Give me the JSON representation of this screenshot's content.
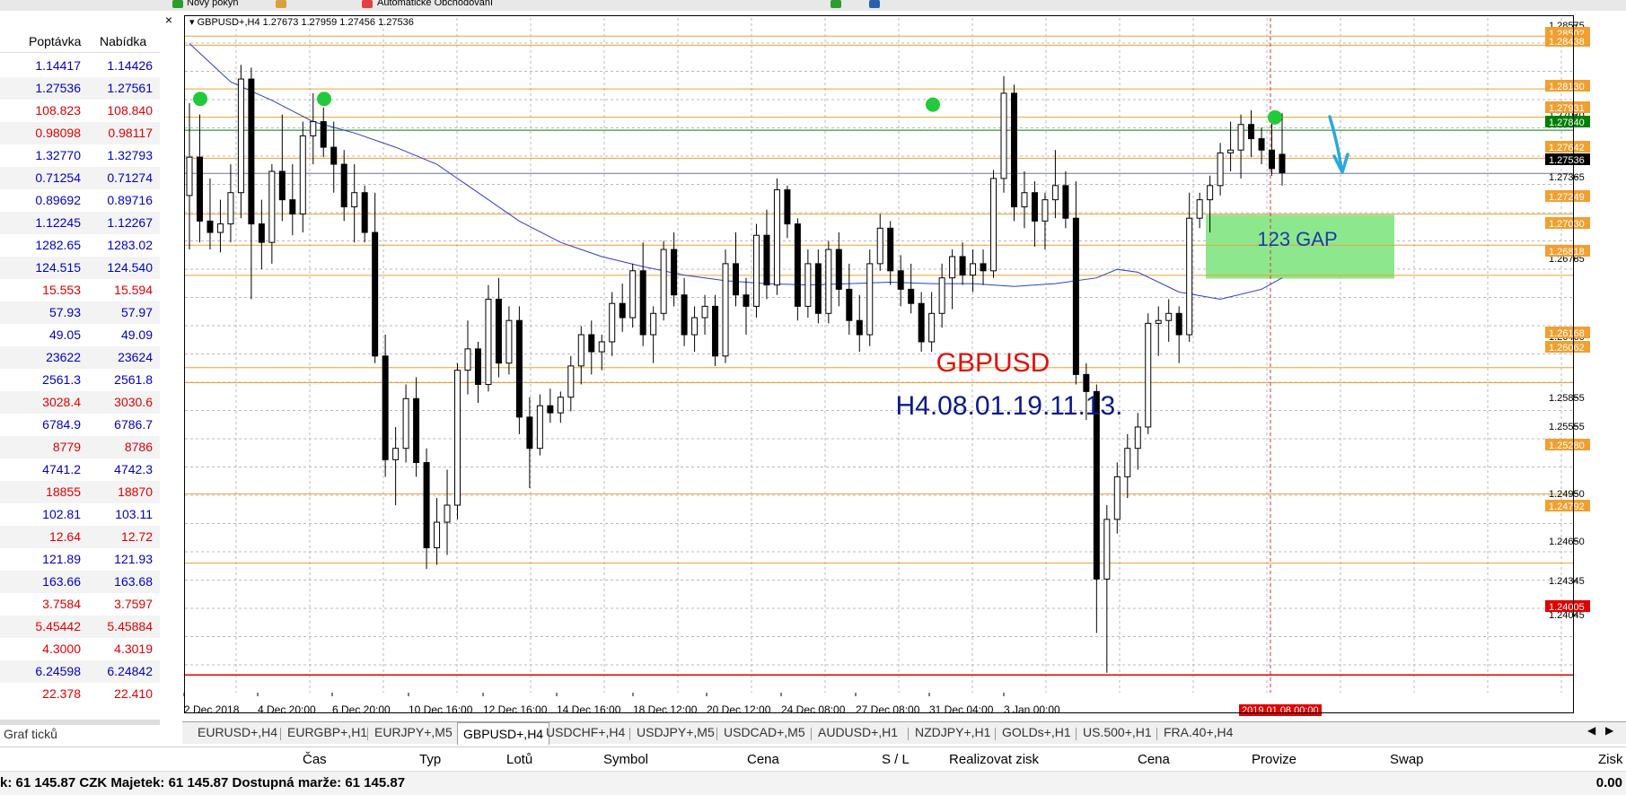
{
  "toolbar": {
    "new_order_label": "Nový pokyn",
    "autotrading_label": "Automatické Obchodování"
  },
  "market_watch": {
    "headers": {
      "bid": "Poptávka",
      "ask": "Nabídka"
    },
    "rows": [
      {
        "bid": "1.14417",
        "ask": "1.14426",
        "color": "#0000c8"
      },
      {
        "bid": "1.27536",
        "ask": "1.27561",
        "color": "#0000c8"
      },
      {
        "bid": "108.823",
        "ask": "108.840",
        "color": "#e00000"
      },
      {
        "bid": "0.98098",
        "ask": "0.98117",
        "color": "#e00000"
      },
      {
        "bid": "1.32770",
        "ask": "1.32793",
        "color": "#0000c8"
      },
      {
        "bid": "0.71254",
        "ask": "0.71274",
        "color": "#0000c8"
      },
      {
        "bid": "0.89692",
        "ask": "0.89716",
        "color": "#0000c8"
      },
      {
        "bid": "1.12245",
        "ask": "1.12267",
        "color": "#0000c8"
      },
      {
        "bid": "1282.65",
        "ask": "1283.02",
        "color": "#0000c8"
      },
      {
        "bid": "124.515",
        "ask": "124.540",
        "color": "#0000c8"
      },
      {
        "bid": "15.553",
        "ask": "15.594",
        "color": "#e00000"
      },
      {
        "bid": "57.93",
        "ask": "57.97",
        "color": "#0000c8"
      },
      {
        "bid": "49.05",
        "ask": "49.09",
        "color": "#0000c8"
      },
      {
        "bid": "23622",
        "ask": "23624",
        "color": "#0000c8"
      },
      {
        "bid": "2561.3",
        "ask": "2561.8",
        "color": "#0000c8"
      },
      {
        "bid": "3028.4",
        "ask": "3030.6",
        "color": "#e00000"
      },
      {
        "bid": "6784.9",
        "ask": "6786.7",
        "color": "#0000c8"
      },
      {
        "bid": "8779",
        "ask": "8786",
        "color": "#e00000"
      },
      {
        "bid": "4741.2",
        "ask": "4742.3",
        "color": "#0000c8"
      },
      {
        "bid": "18855",
        "ask": "18870",
        "color": "#e00000"
      },
      {
        "bid": "102.81",
        "ask": "103.11",
        "color": "#0000c8"
      },
      {
        "bid": "12.64",
        "ask": "12.72",
        "color": "#e00000"
      },
      {
        "bid": "121.89",
        "ask": "121.93",
        "color": "#0000c8"
      },
      {
        "bid": "163.66",
        "ask": "163.68",
        "color": "#0000c8"
      },
      {
        "bid": "3.7584",
        "ask": "3.7597",
        "color": "#e00000"
      },
      {
        "bid": "5.45442",
        "ask": "5.45884",
        "color": "#e00000"
      },
      {
        "bid": "4.3000",
        "ask": "4.3019",
        "color": "#e00000"
      },
      {
        "bid": "6.24598",
        "ask": "6.24842",
        "color": "#0000c8"
      },
      {
        "bid": "22.378",
        "ask": "22.410",
        "color": "#e00000"
      }
    ],
    "tab_label": "Graf ticků"
  },
  "chart_data": {
    "type": "candlestick",
    "symbol_header": "GBPUSD+,H4  1.27673 1.27959 1.27456 1.27536",
    "title": "GBPUSD",
    "subtitle": "H4.08.01.19.11.13.",
    "gap_label": "123 GAP",
    "ylim": [
      1.2388,
      1.2863
    ],
    "price_ticks": [
      "1.28575",
      "1.27070",
      "1.27365",
      "1.26785",
      "1.26460",
      "1.25855",
      "1.25555",
      "1.24950",
      "1.24650",
      "1.24345",
      "1.24045"
    ],
    "time_labels": [
      "2 Dec 2018",
      "4 Dec 20:00",
      "6 Dec 20:00",
      "10 Dec 16:00",
      "12 Dec 16:00",
      "14 Dec 16:00",
      "18 Dec 12:00",
      "20 Dec 12:00",
      "24 Dec 08:00",
      "27 Dec 08:00",
      "31 Dec 04:00",
      "3 Jan 00:00"
    ],
    "current_time_label": "2019.01.08 00:00",
    "horizontal_levels": [
      {
        "price": 1.28502,
        "label": "1.28502",
        "color": "#f0a030"
      },
      {
        "price": 1.28438,
        "label": "1.28438",
        "color": "#f0a030"
      },
      {
        "price": 1.2813,
        "label": "1.28130",
        "color": "#f0a030"
      },
      {
        "price": 1.27931,
        "label": "1.27931",
        "color": "#f0a030"
      },
      {
        "price": 1.2784,
        "label": "1.27840",
        "color": "#008000"
      },
      {
        "price": 1.27642,
        "label": "1.27642",
        "color": "#f0a030"
      },
      {
        "price": 1.27536,
        "label": "1.27536",
        "color": "#000000"
      },
      {
        "price": 1.27249,
        "label": "1.27249",
        "color": "#f0a030"
      },
      {
        "price": 1.2703,
        "label": "1.27030",
        "color": "#f0a030"
      },
      {
        "price": 1.26818,
        "label": "1.26818",
        "color": "#f0a030"
      },
      {
        "price": 1.26168,
        "label": "1.26168",
        "color": "#f0a030"
      },
      {
        "price": 1.26062,
        "label": "1.26062",
        "color": "#f0a030"
      },
      {
        "price": 1.2528,
        "label": "1.25280",
        "color": "#f0a030"
      },
      {
        "price": 1.24792,
        "label": "1.24792",
        "color": "#f0a030"
      },
      {
        "price": 1.24005,
        "label": "1.24005",
        "color": "#e00000"
      }
    ],
    "candles": [
      [
        1.2738,
        1.2803,
        1.27,
        1.2765
      ],
      [
        1.2765,
        1.2795,
        1.2705,
        1.272
      ],
      [
        1.272,
        1.275,
        1.27,
        1.2712
      ],
      [
        1.2712,
        1.2735,
        1.2698,
        1.2718
      ],
      [
        1.2718,
        1.276,
        1.2705,
        1.274
      ],
      [
        1.274,
        1.283,
        1.2722,
        1.282
      ],
      [
        1.282,
        1.2828,
        1.2665,
        1.2718
      ],
      [
        1.2718,
        1.2735,
        1.2686,
        1.2705
      ],
      [
        1.2705,
        1.276,
        1.269,
        1.2755
      ],
      [
        1.2755,
        1.2795,
        1.272,
        1.2735
      ],
      [
        1.2735,
        1.276,
        1.271,
        1.2725
      ],
      [
        1.2725,
        1.279,
        1.2712,
        1.278
      ],
      [
        1.278,
        1.281,
        1.276,
        1.279
      ],
      [
        1.279,
        1.28,
        1.2765,
        1.2772
      ],
      [
        1.2772,
        1.279,
        1.274,
        1.276
      ],
      [
        1.276,
        1.277,
        1.272,
        1.273
      ],
      [
        1.273,
        1.276,
        1.2705,
        1.274
      ],
      [
        1.274,
        1.2745,
        1.2705,
        1.2712
      ],
      [
        1.2712,
        1.274,
        1.262,
        1.2625
      ],
      [
        1.2625,
        1.264,
        1.254,
        1.2552
      ],
      [
        1.2552,
        1.2575,
        1.252,
        1.256
      ],
      [
        1.256,
        1.2605,
        1.255,
        1.2595
      ],
      [
        1.2595,
        1.261,
        1.254,
        1.255
      ],
      [
        1.255,
        1.256,
        1.2475,
        1.249
      ],
      [
        1.249,
        1.2525,
        1.2478,
        1.2508
      ],
      [
        1.2508,
        1.2545,
        1.2485,
        1.252
      ],
      [
        1.252,
        1.262,
        1.251,
        1.2615
      ],
      [
        1.2615,
        1.265,
        1.2598,
        1.263
      ],
      [
        1.263,
        1.2635,
        1.2592,
        1.2605
      ],
      [
        1.2605,
        1.2675,
        1.26,
        1.2665
      ],
      [
        1.2665,
        1.268,
        1.261,
        1.262
      ],
      [
        1.262,
        1.266,
        1.2612,
        1.265
      ],
      [
        1.265,
        1.266,
        1.257,
        1.2582
      ],
      [
        1.2582,
        1.2596,
        1.2532,
        1.256
      ],
      [
        1.256,
        1.2598,
        1.2555,
        1.259
      ],
      [
        1.259,
        1.2602,
        1.2578,
        1.2585
      ],
      [
        1.2585,
        1.26,
        1.2578,
        1.2596
      ],
      [
        1.2596,
        1.2625,
        1.2586,
        1.2618
      ],
      [
        1.2618,
        1.2646,
        1.2605,
        1.264
      ],
      [
        1.264,
        1.265,
        1.2612,
        1.2628
      ],
      [
        1.2628,
        1.264,
        1.2615,
        1.2635
      ],
      [
        1.2635,
        1.267,
        1.2625,
        1.2662
      ],
      [
        1.2662,
        1.2676,
        1.2642,
        1.2652
      ],
      [
        1.2652,
        1.269,
        1.2645,
        1.2685
      ],
      [
        1.2685,
        1.2705,
        1.2632,
        1.264
      ],
      [
        1.264,
        1.266,
        1.262,
        1.2655
      ],
      [
        1.2655,
        1.2706,
        1.265,
        1.27
      ],
      [
        1.27,
        1.2712,
        1.266,
        1.2668
      ],
      [
        1.2668,
        1.268,
        1.2632,
        1.264
      ],
      [
        1.264,
        1.266,
        1.2628,
        1.2652
      ],
      [
        1.2652,
        1.2668,
        1.264,
        1.266
      ],
      [
        1.266,
        1.2668,
        1.2618,
        1.2625
      ],
      [
        1.2625,
        1.27,
        1.262,
        1.269
      ],
      [
        1.269,
        1.2712,
        1.266,
        1.2668
      ],
      [
        1.2668,
        1.268,
        1.264,
        1.266
      ],
      [
        1.266,
        1.2718,
        1.2652,
        1.271
      ],
      [
        1.271,
        1.2728,
        1.2665,
        1.2675
      ],
      [
        1.2675,
        1.275,
        1.2668,
        1.2742
      ],
      [
        1.2742,
        1.2745,
        1.2708,
        1.2718
      ],
      [
        1.2718,
        1.2722,
        1.265,
        1.266
      ],
      [
        1.266,
        1.27,
        1.2652,
        1.269
      ],
      [
        1.269,
        1.27,
        1.2648,
        1.2655
      ],
      [
        1.2655,
        1.2706,
        1.2648,
        1.27
      ],
      [
        1.27,
        1.2712,
        1.266,
        1.2672
      ],
      [
        1.2672,
        1.269,
        1.264,
        1.265
      ],
      [
        1.265,
        1.2668,
        1.2628,
        1.264
      ],
      [
        1.264,
        1.27,
        1.2632,
        1.269
      ],
      [
        1.269,
        1.2725,
        1.2685,
        1.2715
      ],
      [
        1.2715,
        1.272,
        1.2675,
        1.2685
      ],
      [
        1.2685,
        1.2696,
        1.266,
        1.2672
      ],
      [
        1.2672,
        1.269,
        1.2655,
        1.2662
      ],
      [
        1.2662,
        1.267,
        1.2628,
        1.2635
      ],
      [
        1.2635,
        1.267,
        1.2628,
        1.2655
      ],
      [
        1.2655,
        1.269,
        1.2645,
        1.268
      ],
      [
        1.268,
        1.27,
        1.2658,
        1.2695
      ],
      [
        1.2695,
        1.2705,
        1.2675,
        1.2682
      ],
      [
        1.2682,
        1.27,
        1.267,
        1.269
      ],
      [
        1.269,
        1.27,
        1.2675,
        1.2685
      ],
      [
        1.2685,
        1.2756,
        1.268,
        1.275
      ],
      [
        1.275,
        1.2822,
        1.274,
        1.281
      ],
      [
        1.281,
        1.2816,
        1.272,
        1.273
      ],
      [
        1.273,
        1.2755,
        1.2715,
        1.274
      ],
      [
        1.274,
        1.2748,
        1.2702,
        1.272
      ],
      [
        1.272,
        1.274,
        1.27,
        1.2735
      ],
      [
        1.2735,
        1.277,
        1.2722,
        1.2745
      ],
      [
        1.2745,
        1.2755,
        1.2715,
        1.2722
      ],
      [
        1.2722,
        1.2748,
        1.2605,
        1.2612
      ],
      [
        1.2612,
        1.262,
        1.258,
        1.26
      ],
      [
        1.26,
        1.2605,
        1.243,
        1.2468
      ],
      [
        1.2468,
        1.252,
        1.2402,
        1.251
      ],
      [
        1.251,
        1.255,
        1.25,
        1.254
      ],
      [
        1.254,
        1.257,
        1.2525,
        1.256
      ],
      [
        1.256,
        1.2585,
        1.2545,
        1.2575
      ],
      [
        1.2575,
        1.2655,
        1.257,
        1.2648
      ],
      [
        1.2648,
        1.266,
        1.2625,
        1.265
      ],
      [
        1.265,
        1.2665,
        1.2635,
        1.2655
      ],
      [
        1.2655,
        1.266,
        1.262,
        1.264
      ],
      [
        1.264,
        1.274,
        1.2635,
        1.2722
      ],
      [
        1.2722,
        1.274,
        1.2715,
        1.2735
      ],
      [
        1.2735,
        1.2752,
        1.2712,
        1.2745
      ],
      [
        1.2745,
        1.2775,
        1.2738,
        1.2768
      ],
      [
        1.2768,
        1.279,
        1.2755,
        1.277
      ],
      [
        1.277,
        1.2795,
        1.275,
        1.2788
      ],
      [
        1.2788,
        1.2798,
        1.2765,
        1.2778
      ],
      [
        1.2778,
        1.2786,
        1.276,
        1.277
      ],
      [
        1.277,
        1.2789,
        1.2752,
        1.2757
      ],
      [
        1.2767,
        1.2796,
        1.2745,
        1.2754
      ]
    ],
    "ma_curve": [
      [
        0,
        1.2845
      ],
      [
        40,
        1.2818
      ],
      [
        80,
        1.2805
      ],
      [
        120,
        1.279
      ],
      [
        160,
        1.2782
      ],
      [
        200,
        1.2772
      ],
      [
        240,
        1.276
      ],
      [
        280,
        1.274
      ],
      [
        320,
        1.272
      ],
      [
        360,
        1.2705
      ],
      [
        400,
        1.2695
      ],
      [
        440,
        1.2688
      ],
      [
        480,
        1.2682
      ],
      [
        520,
        1.2678
      ],
      [
        560,
        1.2676
      ],
      [
        600,
        1.2675
      ],
      [
        640,
        1.2676
      ],
      [
        680,
        1.2677
      ],
      [
        720,
        1.2676
      ],
      [
        760,
        1.2676
      ],
      [
        800,
        1.2674
      ],
      [
        840,
        1.2676
      ],
      [
        880,
        1.268
      ],
      [
        900,
        1.2686
      ],
      [
        920,
        1.2684
      ],
      [
        960,
        1.267
      ],
      [
        1000,
        1.2665
      ],
      [
        1040,
        1.2672
      ],
      [
        1060,
        1.268
      ]
    ]
  },
  "chart_tabs": [
    "EURUSD+,H4",
    "EURGBP+,H1",
    "EURJPY+,M5",
    "GBPUSD+,H4",
    "USDCHF+,H4",
    "USDJPY+,M5",
    "USDCAD+,M5",
    "AUDUSD+,H1",
    "NZDJPY+,H1",
    "GOLDs+,H1",
    "US.500+,H1",
    "FRA.40+,H4"
  ],
  "active_tab": "GBPUSD+,H4",
  "terminal": {
    "columns": [
      "Čas",
      "Typ",
      "Lotů",
      "Symbol",
      "Cena",
      "S / L",
      "Realizovat zisk",
      "Cena",
      "Provize",
      "Swap",
      "Zisk"
    ]
  },
  "status": {
    "text": "k: 61 145.87 CZK  Majetek: 61 145.87  Dostupná marže: 61 145.87",
    "profit": "0.00"
  }
}
